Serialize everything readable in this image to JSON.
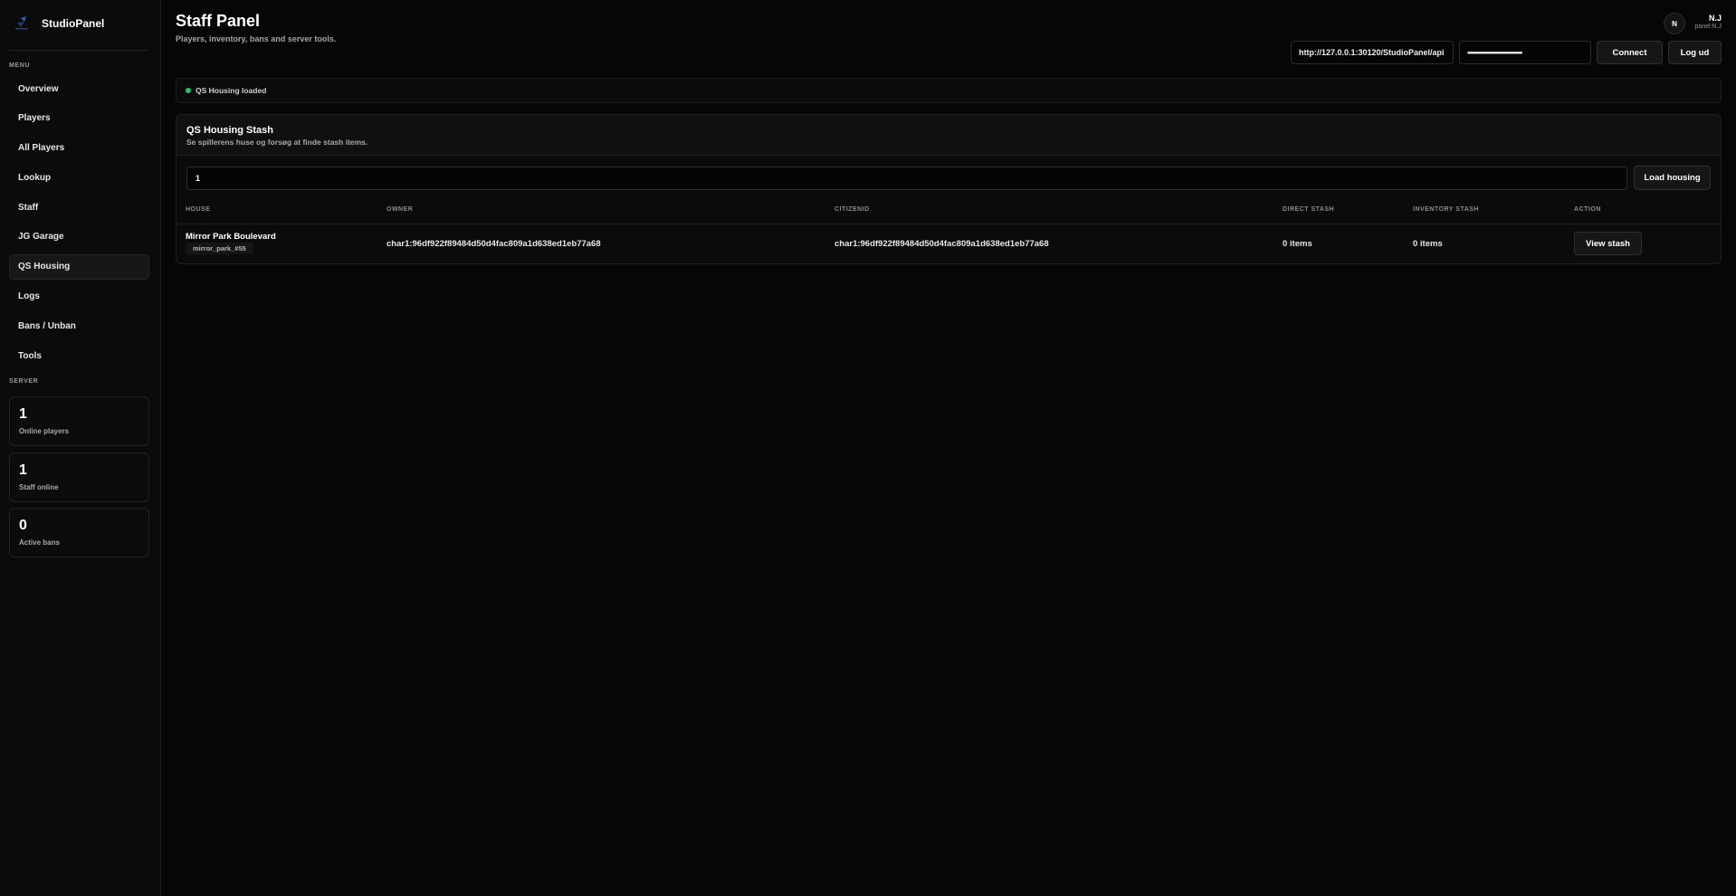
{
  "app": {
    "name": "StudioPanel"
  },
  "sidebar": {
    "menu_label": "MENU",
    "items": [
      {
        "label": "Overview"
      },
      {
        "label": "Players"
      },
      {
        "label": "All Players"
      },
      {
        "label": "Lookup"
      },
      {
        "label": "Staff"
      },
      {
        "label": "JG Garage"
      },
      {
        "label": "QS Housing",
        "active": true
      },
      {
        "label": "Logs"
      },
      {
        "label": "Bans / Unban"
      },
      {
        "label": "Tools"
      }
    ],
    "server_label": "SERVER",
    "stats": [
      {
        "value": "1",
        "label": "Online players"
      },
      {
        "value": "1",
        "label": "Staff online"
      },
      {
        "value": "0",
        "label": "Active bans"
      }
    ]
  },
  "header": {
    "title": "Staff Panel",
    "subtitle": "Players, inventory, bans and server tools.",
    "user": {
      "initial": "N",
      "name": "N.J",
      "handle": "panel:N.J"
    },
    "api_url": "http://127.0.0.1:30120/StudioPanel/api",
    "token_mask": "••••••••••••••••••••••••••••••••••••••••••••••",
    "connect_label": "Connect",
    "logout_label": "Log ud"
  },
  "status": {
    "text": "QS Housing loaded",
    "color": "#2bbf6a"
  },
  "housing": {
    "title": "QS Housing Stash",
    "subtitle": "Se spillerens huse og forsøg at finde stash items.",
    "search_value": "1",
    "load_label": "Load housing",
    "columns": [
      "HOUSE",
      "OWNER",
      "CITIZENID",
      "DIRECT STASH",
      "INVENTORY STASH",
      "ACTION"
    ],
    "rows": [
      {
        "house": "Mirror Park Boulevard",
        "house_id": "mirror_park_#55",
        "owner": "char1:96df922f89484d50d4fac809a1d638ed1eb77a68",
        "citizenid": "char1:96df922f89484d50d4fac809a1d638ed1eb77a68",
        "direct_stash": "0 items",
        "inventory_stash": "0 items",
        "action_label": "View stash"
      }
    ]
  }
}
